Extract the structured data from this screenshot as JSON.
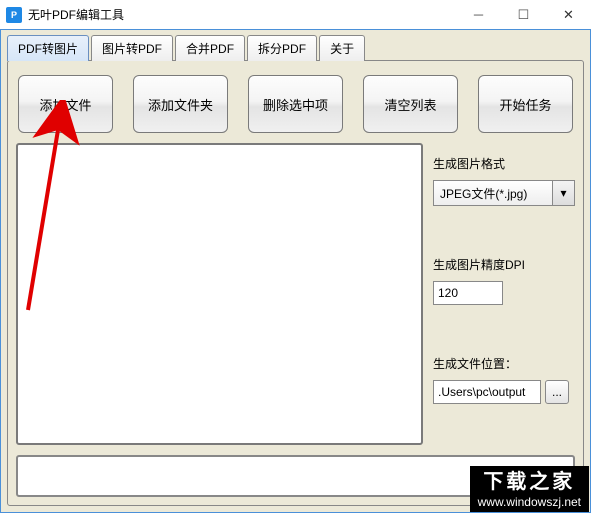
{
  "window": {
    "title": "无叶PDF编辑工具",
    "icon_label": "PDF"
  },
  "tabs": [
    {
      "label": "PDF转图片",
      "active": true
    },
    {
      "label": "图片转PDF",
      "active": false
    },
    {
      "label": "合并PDF",
      "active": false
    },
    {
      "label": "拆分PDF",
      "active": false
    },
    {
      "label": "关于",
      "active": false
    }
  ],
  "buttons": {
    "add_file": "添加文件",
    "add_folder": "添加文件夹",
    "del_selected": "删除选中项",
    "clear_list": "清空列表",
    "start_task": "开始任务"
  },
  "side": {
    "format_label": "生成图片格式",
    "format_value": "JPEG文件(*.jpg)",
    "dpi_label": "生成图片精度DPI",
    "dpi_value": "120",
    "path_label": "生成文件位置：",
    "path_value": ".Users\\pc\\output",
    "browse": "..."
  },
  "watermark": {
    "line1": "下载之家",
    "line2": "www.windowszj.net"
  }
}
